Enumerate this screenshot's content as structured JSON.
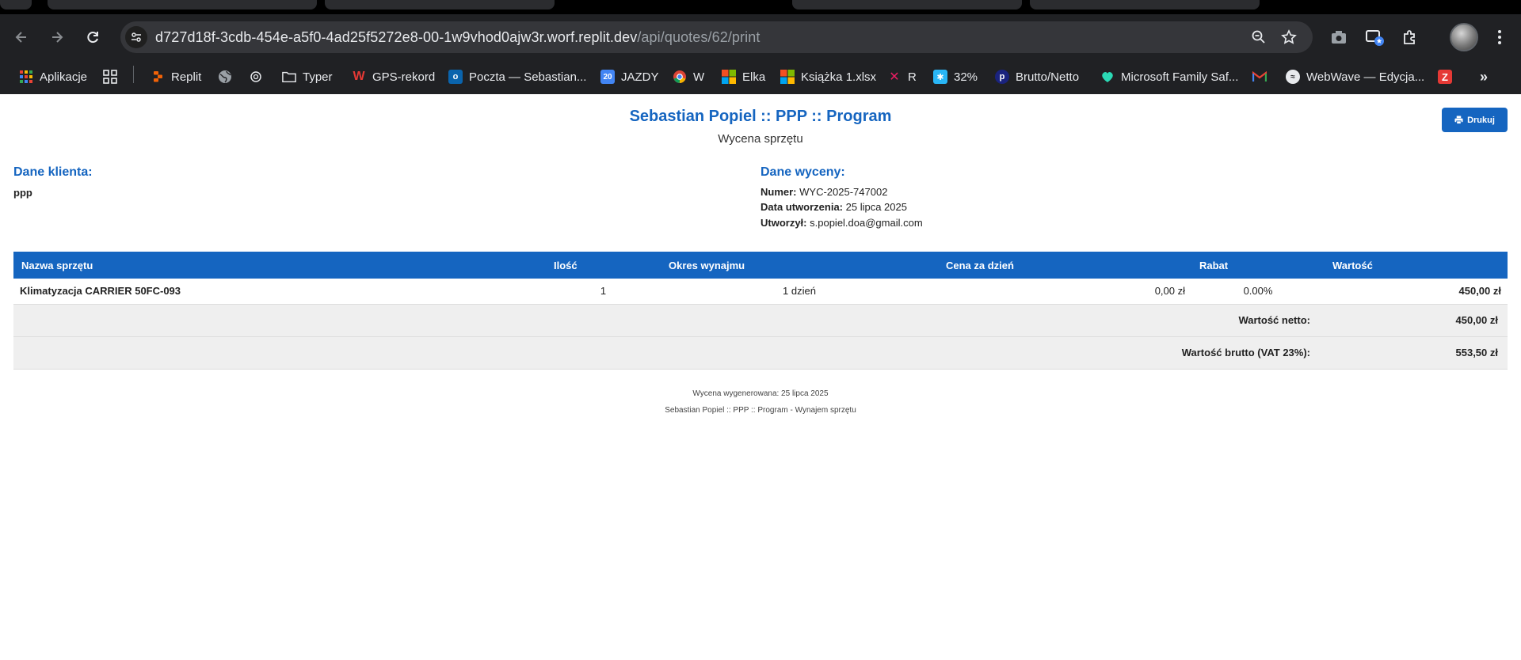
{
  "browser": {
    "url_host": "d727d18f-3cdb-454e-a5f0-4ad25f5272e8-00-1w9vhod0ajw3r.worf.replit.dev",
    "url_path": "/api/quotes/62/print",
    "bookmarks": [
      {
        "label": "Aplikacje",
        "icon": "apps-grid-icon"
      },
      {
        "label": "",
        "icon": "grid-icon"
      },
      {
        "label": "Replit",
        "icon": "replit-icon"
      },
      {
        "label": "",
        "icon": "globe-icon"
      },
      {
        "label": "",
        "icon": "openai-icon"
      },
      {
        "label": "Typer",
        "icon": "folder-icon"
      },
      {
        "label": "GPS-rekord",
        "icon": "gps-rekord-icon"
      },
      {
        "label": "Poczta — Sebastian...",
        "icon": "outlook-icon"
      },
      {
        "label": "JAZDY",
        "icon": "calendar-icon",
        "icon_text": "20"
      },
      {
        "label": "W",
        "icon": "chrome-icon"
      },
      {
        "label": "Elka",
        "icon": "microsoft-icon"
      },
      {
        "label": "Książka 1.xlsx",
        "icon": "microsoft-icon"
      },
      {
        "label": "R",
        "icon": "r-app-icon"
      },
      {
        "label": "32%",
        "icon": "bulb-icon"
      },
      {
        "label": "Brutto/Netto",
        "icon": "p-icon"
      },
      {
        "label": "Microsoft Family Saf...",
        "icon": "family-safety-icon"
      },
      {
        "label": "",
        "icon": "gmail-icon"
      },
      {
        "label": "WebWave — Edycja...",
        "icon": "webwave-icon"
      },
      {
        "label": "",
        "icon": "z-icon"
      }
    ]
  },
  "page": {
    "title": "Sebastian Popiel :: PPP :: Program",
    "subtitle": "Wycena sprzętu",
    "print_label": "Drukuj",
    "client": {
      "heading": "Dane klienta:",
      "name": "ppp"
    },
    "quote": {
      "heading": "Dane wyceny:",
      "number_label": "Numer:",
      "number": "WYC-2025-747002",
      "created_label": "Data utworzenia:",
      "created": "25 lipca 2025",
      "author_label": "Utworzył:",
      "author": "s.popiel.doa@gmail.com"
    },
    "table": {
      "headers": [
        "Nazwa sprzętu",
        "Ilość",
        "Okres wynajmu",
        "Cena za dzień",
        "Rabat",
        "Wartość"
      ],
      "rows": [
        {
          "name": "Klimatyzacja CARRIER 50FC-093",
          "qty": "1",
          "period": "1 dzień",
          "price": "0,00 zł",
          "discount": "0.00%",
          "value": "450,00 zł"
        }
      ],
      "net_label": "Wartość netto:",
      "net_value": "450,00 zł",
      "gross_label": "Wartość brutto (VAT 23%):",
      "gross_value": "553,50 zł"
    },
    "footer": {
      "generated": "Wycena wygenerowana: 25 lipca 2025",
      "brand": "Sebastian Popiel :: PPP :: Program - Wynajem sprzętu"
    }
  },
  "colors": {
    "accent": "#1565c0",
    "chrome_bg": "#202124",
    "summary_bg": "#efefef"
  }
}
